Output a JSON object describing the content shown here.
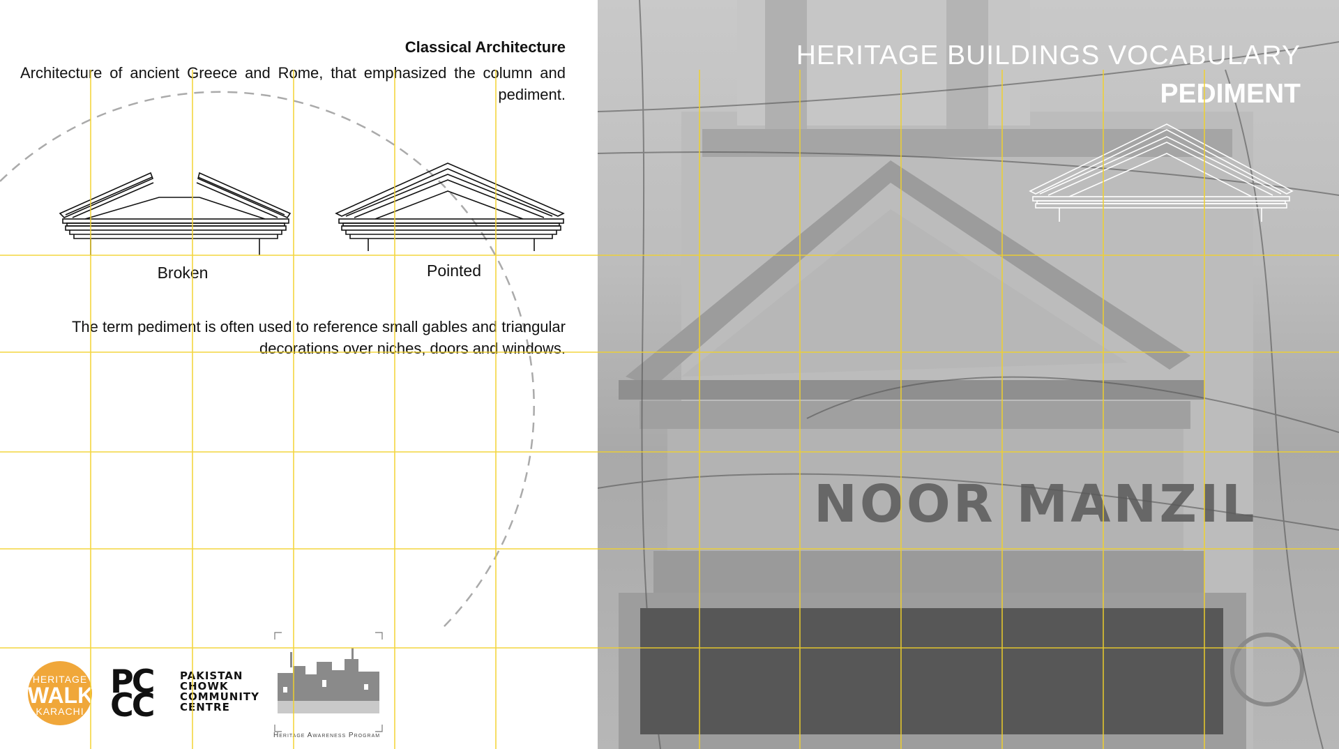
{
  "colors": {
    "guide": "#f2d22a",
    "guide_dark": "#e0a800",
    "accent": "#f0a73a",
    "dark_box": "#575757"
  },
  "left": {
    "heading": "Classical Architecture",
    "intro": "Architecture of ancient Greece and Rome, that emphasized the column and pediment.",
    "captions": {
      "broken": "Broken",
      "pointed": "Pointed"
    },
    "note": "The term pediment is often used to reference small gables and triangular decorations over niches, doors and windows."
  },
  "right": {
    "title_line1": "HERITAGE BUILDINGS VOCABULARY",
    "title_line2": "PEDIMENT",
    "sign_text": "NOOR MANZIL"
  },
  "logos": {
    "heritage_walk": {
      "line1": "HERITAGE",
      "line2": "WALK",
      "line3": "KARACHI"
    },
    "pccc": {
      "mark": "PC\nCC",
      "text": "PAKISTAN\nCHOWK\nCOMMUNITY\nCENTRE"
    },
    "heritage_awareness": {
      "caption": "Heritage Awareness Program"
    }
  }
}
